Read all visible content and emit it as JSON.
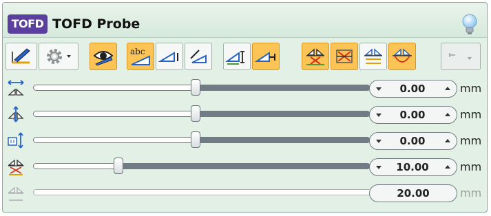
{
  "header": {
    "logo": "TOFD",
    "title": "TOFD Probe"
  },
  "toolbar": {
    "buttons": [
      {
        "name": "edit-probe-button",
        "icon": "pencil-ruler-icon",
        "active": false
      },
      {
        "name": "settings-button",
        "icon": "gear-icon",
        "active": false
      },
      {
        "name": "view-button",
        "icon": "eye-icon",
        "active": true
      },
      {
        "name": "label-button",
        "icon": "abc-wedge-icon",
        "active": true
      },
      {
        "name": "wedge-angle-button",
        "icon": "wedge-icon",
        "active": false
      },
      {
        "name": "wedge-rotate-button",
        "icon": "wedge-rotate-icon",
        "active": false
      },
      {
        "name": "probe-position-button",
        "icon": "probe-height-icon",
        "active": false
      },
      {
        "name": "probe-offset-button",
        "icon": "probe-offset-icon",
        "active": true
      },
      {
        "name": "beam-cross-button",
        "icon": "beam-cross-icon",
        "active": true
      },
      {
        "name": "beam-hide-button",
        "icon": "beam-hide-icon",
        "active": true
      },
      {
        "name": "beam-lines-button",
        "icon": "beam-lines-icon",
        "active": false
      },
      {
        "name": "beam-arc-button",
        "icon": "beam-arc-icon",
        "active": true
      },
      {
        "name": "more-menu-button",
        "icon": "dropdown-icon",
        "active": false
      }
    ]
  },
  "rows": [
    {
      "icon": "horizontal-offset-icon",
      "value": "0.00",
      "unit": "mm",
      "position": 0.482,
      "enabled": true
    },
    {
      "icon": "vertical-offset-icon",
      "value": "0.00",
      "unit": "mm",
      "position": 0.482,
      "enabled": true
    },
    {
      "icon": "skew-offset-icon",
      "value": "0.00",
      "unit": "mm",
      "position": 0.482,
      "enabled": true
    },
    {
      "icon": "probe-separation-icon",
      "value": "10.00",
      "unit": "mm",
      "position": 0.254,
      "enabled": true
    },
    {
      "icon": "pcs-icon",
      "value": "20.00",
      "unit": "mm",
      "position": null,
      "enabled": false
    }
  ]
}
